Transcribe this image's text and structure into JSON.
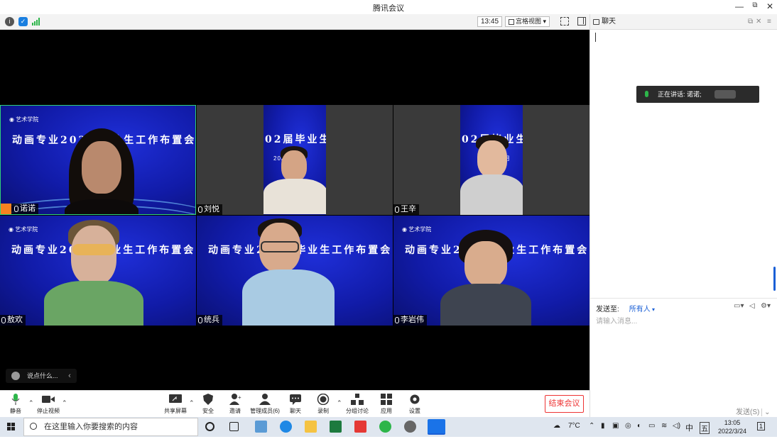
{
  "window": {
    "title": "腾讯会议"
  },
  "toolbar_top": {
    "clock": "13:45",
    "view_mode": "宫格视图"
  },
  "participants": [
    {
      "name": "诺诺",
      "host": true,
      "slide_title": "动画专业202届毕业生工作布置会"
    },
    {
      "name": "刘悦",
      "host": false,
      "slide_title": "02届毕业生",
      "slide_date": "2022年3月"
    },
    {
      "name": "王辛",
      "host": false,
      "slide_title": "02届毕业生",
      "slide_date": "月"
    },
    {
      "name": "敖欢",
      "host": false,
      "slide_title": "动画专业202届毕业生工作布置会"
    },
    {
      "name": "统兵",
      "host": false,
      "slide_title": "动画专业202届毕业生工作布置会"
    },
    {
      "name": "李岩伟",
      "host": false,
      "slide_title": "动画专业202届毕业生工作布置会"
    }
  ],
  "chat_quick": {
    "placeholder": "说点什么..."
  },
  "bottom_toolbar": {
    "mute": "静音",
    "stop_video": "停止视频",
    "share_screen": "共享屏幕",
    "security": "安全",
    "invite": "邀请",
    "manage_members": "管理成员(6)",
    "chat": "聊天",
    "record": "录制",
    "breakout": "分组讨论",
    "apps": "应用",
    "settings": "设置",
    "end_meeting": "结束会议"
  },
  "chat_panel": {
    "title": "聊天",
    "speaking_label": "正在讲话: 诺诺;",
    "send_to_label": "发送至:",
    "send_to_value": "所有人",
    "input_placeholder": "请输入消息...",
    "send_button": "发送(S)"
  },
  "taskbar": {
    "search_placeholder": "在这里输入你要搜索的内容",
    "weather": "7°C",
    "ime": "中",
    "ime2": "五",
    "time": "13:05",
    "date": "2022/3/24",
    "notifications": "1"
  },
  "colors": {
    "accent": "#1a5fd6",
    "end_meeting": "#e33333",
    "host_badge": "#f58220",
    "slide_blue": "#1724c8"
  }
}
